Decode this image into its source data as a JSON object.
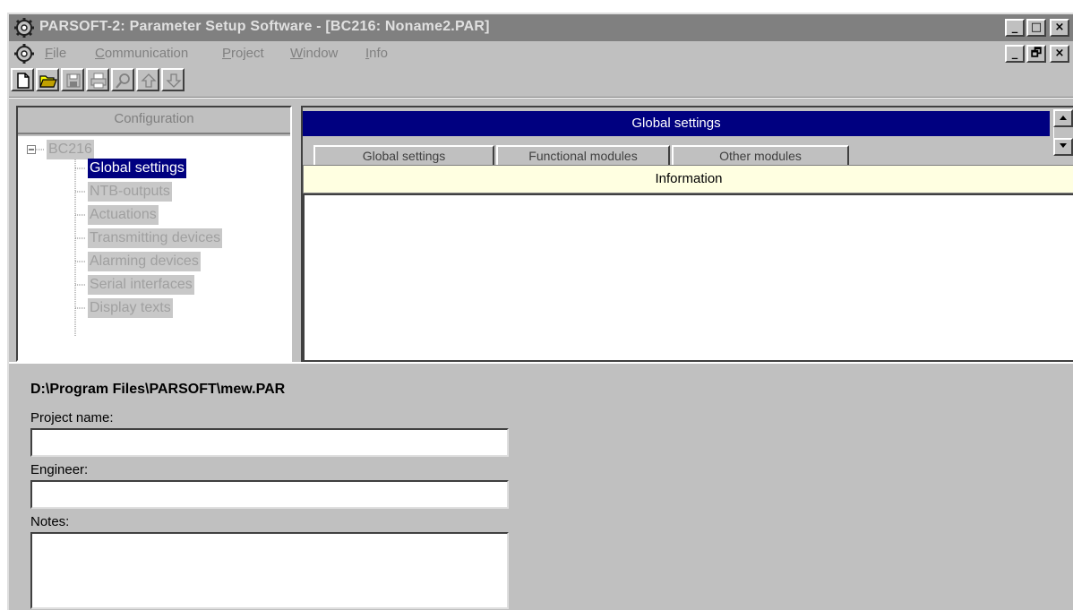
{
  "window": {
    "title": "PARSOFT-2: Parameter Setup Software - [BC216: Noname2.PAR]",
    "caption_buttons": [
      "_",
      "□",
      "×"
    ],
    "mdi_buttons": [
      "_",
      "🗗",
      "×"
    ]
  },
  "menu": {
    "items": [
      {
        "label": "File",
        "key": "F"
      },
      {
        "label": "Communication",
        "key": "C"
      },
      {
        "label": "Project",
        "key": "P"
      },
      {
        "label": "Window",
        "key": "W"
      },
      {
        "label": "Info",
        "key": "I"
      }
    ]
  },
  "toolbar": {
    "buttons": [
      "new-icon",
      "open-icon",
      "save-icon",
      "print-icon",
      "find-icon",
      "upload-icon",
      "download-icon"
    ]
  },
  "configuration": {
    "title": "Configuration",
    "root": "BC216",
    "items": [
      "Global settings",
      "NTB-outputs",
      "Actuations",
      "Transmitting devices",
      "Alarming devices",
      "Serial interfaces",
      "Display texts"
    ],
    "selected_index": 0
  },
  "panel": {
    "title": "Global settings",
    "tabs": [
      "Global settings",
      "Functional modules",
      "Other modules"
    ],
    "information_label": "Information"
  },
  "project": {
    "path": "D:\\Program Files\\PARSOFT\\mew.PAR",
    "project_name_label": "Project name:",
    "project_name_value": "",
    "engineer_label": "Engineer:",
    "engineer_value": "",
    "notes_label": "Notes:",
    "notes_value": ""
  },
  "colors": {
    "titlebar": "#808080",
    "selection": "#000080",
    "info_background": "#ffffe1",
    "window_face": "#c0c0c0"
  }
}
